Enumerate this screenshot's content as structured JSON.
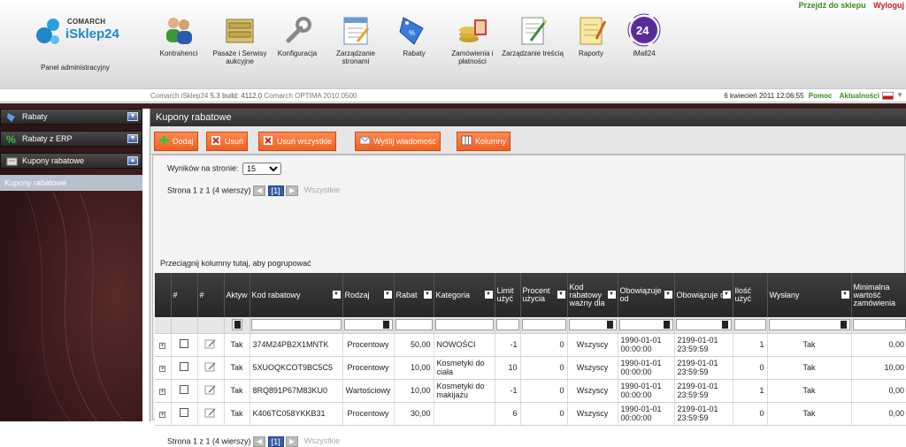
{
  "toplinks": {
    "shop": "Przejdź do sklepu",
    "logout": "Wyloguj"
  },
  "brand": {
    "company": "COMARCH",
    "product": "iSklep24",
    "panel": "Panel administracyjny"
  },
  "modules": [
    {
      "label": "Kontrahenci",
      "icon": "contacts-icon"
    },
    {
      "label": "Pasaże i Serwisy aukcyjne",
      "icon": "drawer-icon"
    },
    {
      "label": "Konfiguracja",
      "icon": "wrench-icon"
    },
    {
      "label": "Zarządzanie stronami",
      "icon": "page-edit-icon"
    },
    {
      "label": "Rabaty",
      "icon": "discount-tag-icon"
    },
    {
      "label": "Zamówienia i płatności",
      "icon": "coins-icon"
    },
    {
      "label": "Zarządzanie treścią",
      "icon": "content-edit-icon"
    },
    {
      "label": "Raporty",
      "icon": "notepad-icon"
    },
    {
      "label": "iMall24",
      "icon": "imall-icon"
    }
  ],
  "verbar": {
    "version_prefix": "Comarch iSklep24",
    "version": "5.3 build: 4112.0",
    "erp": "Comarch OPTIMA 2010.0500",
    "datetime": "6 kwiecień 2011 12:06:55",
    "help": "Pomoc",
    "news": "Aktualności"
  },
  "sidebar": {
    "items": [
      {
        "label": "Rabaty",
        "state": "collapsed"
      },
      {
        "label": "Rabaty z ERP",
        "state": "collapsed"
      },
      {
        "label": "Kupony rabatowe",
        "state": "expanded"
      }
    ],
    "subitem": "Kupony rabatowe"
  },
  "main": {
    "title": "Kupony rabatowe",
    "toolbar": {
      "add": "Dodaj",
      "delete": "Usuń",
      "delete_all": "Usuń wszystkie",
      "send": "Wyślij wiadomość",
      "columns": "Kolumny"
    },
    "perpage_label": "Wyników na stronie:",
    "perpage_value": "15",
    "pager": {
      "text": "Strona 1 z 1 (4 wierszy)",
      "current": "[1]",
      "all": "Wszystkie"
    },
    "group_hint": "Przeciągnij kolumny tutaj, aby pogrupować"
  },
  "grid": {
    "headers": [
      "#",
      "#",
      "Aktyw",
      "Kod rabatowy",
      "Rodzaj",
      "Rabat",
      "Kategoria",
      "Limit użyć",
      "Procent użycia",
      "Kod rabatowy ważny dla",
      "Obowiązuje od",
      "Obowiązuje do",
      "Ilość użyć",
      "Wysłany",
      "Minimalna wartość zamówienia"
    ],
    "rows": [
      {
        "aktyw": "Tak",
        "kod": "374M24PB2X1MNTK",
        "rodzaj": "Procentowy",
        "rabat": "50,00",
        "kategoria": "NOWOŚCI",
        "limit": "-1",
        "procent": "0",
        "wazny": "Wszyscy",
        "od": "1990-01-01 00:00:00",
        "do": "2199-01-01 23:59:59",
        "ilosc": "1",
        "wyslany": "Tak",
        "min": "0,00"
      },
      {
        "aktyw": "Tak",
        "kod": "5XUOQKCOT9BC5C5",
        "rodzaj": "Procentowy",
        "rabat": "10,00",
        "kategoria": "Kosmetyki do ciała",
        "limit": "10",
        "procent": "0",
        "wazny": "Wszyscy",
        "od": "1990-01-01 00:00:00",
        "do": "2199-01-01 23:59:59",
        "ilosc": "0",
        "wyslany": "Tak",
        "min": "10,00"
      },
      {
        "aktyw": "Tak",
        "kod": "8RQ891P67M83KU0",
        "rodzaj": "Wartościowy",
        "rabat": "10,00",
        "kategoria": "Kosmetyki do makijażu",
        "limit": "-1",
        "procent": "0",
        "wazny": "Wszyscy",
        "od": "1990-01-01 00:00:00",
        "do": "2199-01-01 23:59:59",
        "ilosc": "1",
        "wyslany": "Tak",
        "min": "0,00"
      },
      {
        "aktyw": "Tak",
        "kod": "K406TC058YKKB31",
        "rodzaj": "Procentowy",
        "rabat": "30,00",
        "kategoria": "",
        "limit": "6",
        "procent": "0",
        "wazny": "Wszyscy",
        "od": "1990-01-01 00:00:00",
        "do": "2199-01-01 23:59:59",
        "ilosc": "0",
        "wyslany": "Tak",
        "min": "0,00"
      }
    ]
  },
  "colors": {
    "accent_orange": "#f06020",
    "link_green": "#3a8a1a",
    "logout_red": "#c41a1a",
    "brand_blue": "#1e88c8"
  }
}
